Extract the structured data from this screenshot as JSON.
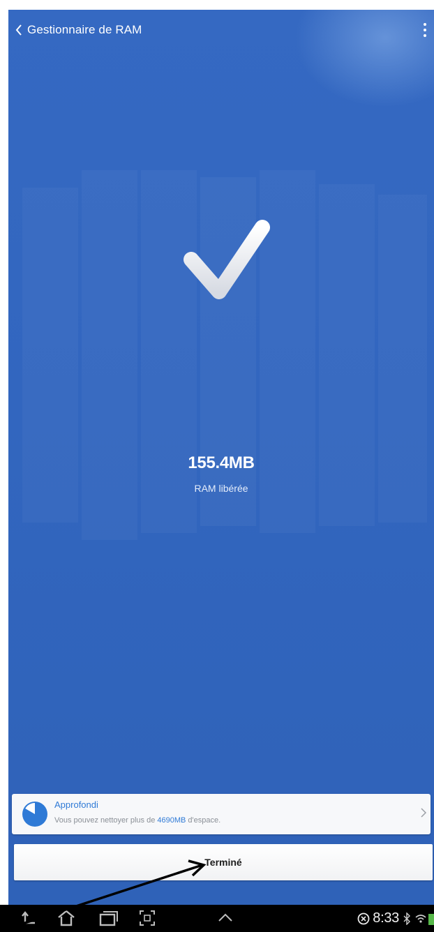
{
  "header": {
    "title": "Gestionnaire de RAM"
  },
  "result": {
    "value": "155.4MB",
    "label": "RAM libérée"
  },
  "card": {
    "title": "Approfondi",
    "desc_prefix": "Vous pouvez nettoyer plus de ",
    "desc_highlight": "4690MB",
    "desc_suffix": " d'espace."
  },
  "done_button": {
    "label": "Terminé"
  },
  "statusbar": {
    "time": "8:33"
  },
  "icons": {
    "back": "chevron-left-icon",
    "menu": "overflow-menu-icon",
    "check": "checkmark-icon",
    "card": "pie-icon",
    "chevron": "chevron-right-icon",
    "nav": [
      "back-nav-icon",
      "home-nav-icon",
      "recent-apps-icon",
      "screenshot-icon",
      "up-arrow-icon"
    ],
    "status": [
      "sync-icon",
      "bluetooth-icon",
      "wifi-icon",
      "battery-icon"
    ]
  },
  "colors": {
    "background": "#3266bf",
    "accent": "#2f7ad6",
    "card": "#f7f8fa",
    "navbar": "#000000"
  }
}
